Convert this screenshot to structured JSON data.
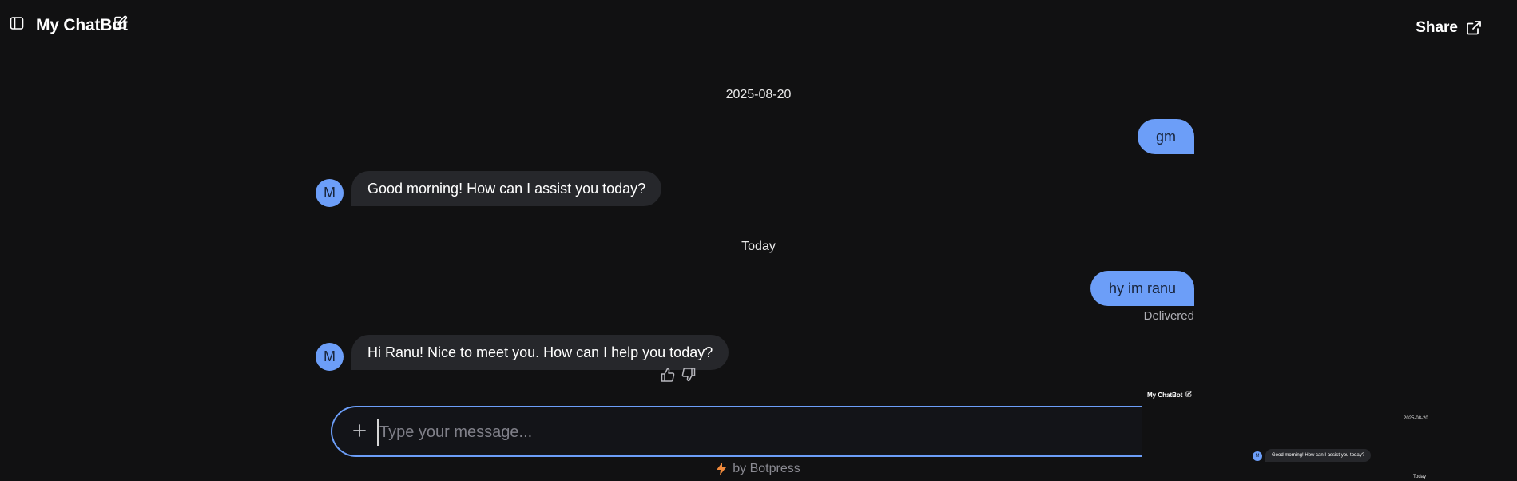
{
  "header": {
    "title": "My ChatBot",
    "share_label": "Share",
    "icons": {
      "sidebar_toggle": "sidebar-panel-icon",
      "edit": "edit-icon",
      "share": "external-link-icon"
    }
  },
  "conversation": {
    "date_separators": [
      "2025-08-20",
      "Today"
    ],
    "messages": [
      {
        "role": "user",
        "text": "gm"
      },
      {
        "role": "bot",
        "avatar": "M",
        "text": "Good morning! How can I assist you today?"
      },
      {
        "role": "user",
        "text": "hy im ranu",
        "status": "Delivered"
      },
      {
        "role": "bot",
        "avatar": "M",
        "text": "Hi Ranu! Nice to meet you. How can I help you today?"
      }
    ]
  },
  "composer": {
    "placeholder": "Type your message...",
    "value": ""
  },
  "footer": {
    "powered_by": "by Botpress"
  },
  "preview": {
    "title": "My ChatBot",
    "date": "2025-08-20",
    "avatar": "M",
    "message": "Good morning! How can I assist you today?",
    "today": "Today"
  },
  "colors": {
    "background": "#111112",
    "accent": "#6c9ef8",
    "bot_bubble": "#26272b",
    "user_text": "#18243a",
    "muted": "#b0b0b6",
    "bolt": "#f08a3c"
  }
}
